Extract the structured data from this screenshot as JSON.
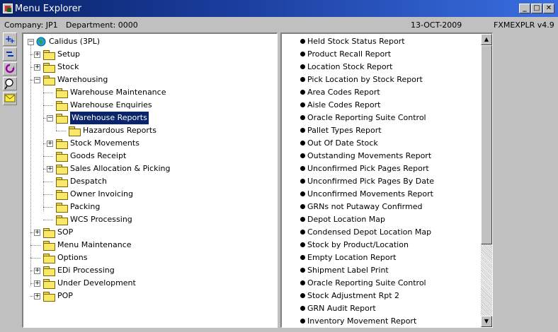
{
  "window": {
    "title": "Menu Explorer"
  },
  "infobar": {
    "company": "Company:  JP1",
    "department": "Department:  0000",
    "date": "13-OCT-2009",
    "program": "FXMEXPLR  v4.9"
  },
  "toolbar": [
    "expand-all-icon",
    "collapse-all-icon",
    "refresh-icon",
    "search-icon",
    "mail-icon"
  ],
  "tree": {
    "root": "Calidus (3PL)",
    "items": [
      {
        "label": "Setup"
      },
      {
        "label": "Stock"
      },
      {
        "label": "Warehousing"
      },
      {
        "label": "Warehouse Maintenance"
      },
      {
        "label": "Warehouse Enquiries"
      },
      {
        "label": "Warehouse Reports"
      },
      {
        "label": "Hazardous Reports"
      },
      {
        "label": "Stock Movements"
      },
      {
        "label": "Goods Receipt"
      },
      {
        "label": "Sales Allocation & Picking"
      },
      {
        "label": "Despatch"
      },
      {
        "label": "Owner Invoicing"
      },
      {
        "label": "Packing"
      },
      {
        "label": "WCS Processing"
      },
      {
        "label": "SOP"
      },
      {
        "label": "Menu Maintenance"
      },
      {
        "label": "Options"
      },
      {
        "label": "EDi Processing"
      },
      {
        "label": "Under Development"
      },
      {
        "label": "POP"
      }
    ]
  },
  "reports": [
    "Held Stock Status Report",
    "Product Recall Report",
    "Location Stock Report",
    "Pick Location by Stock Report",
    "Area Codes Report",
    "Aisle Codes Report",
    "Oracle Reporting Suite Control",
    "Pallet Types Report",
    "Out Of Date Stock",
    "Outstanding Movements Report",
    "Unconfirmed Pick Pages Report",
    "Unconfirmed Pick Pages By Date",
    "Unconfirmed Movements Report",
    "GRNs not Putaway Confirmed",
    "Depot Location Map",
    "Condensed Depot Location Map",
    "Stock by Product/Location",
    "Empty Location Report",
    "Shipment Label Print",
    "Oracle Reporting Suite Control",
    "Stock Adjustment Rpt 2",
    "GRN Audit Report",
    "Inventory Movement Report"
  ]
}
